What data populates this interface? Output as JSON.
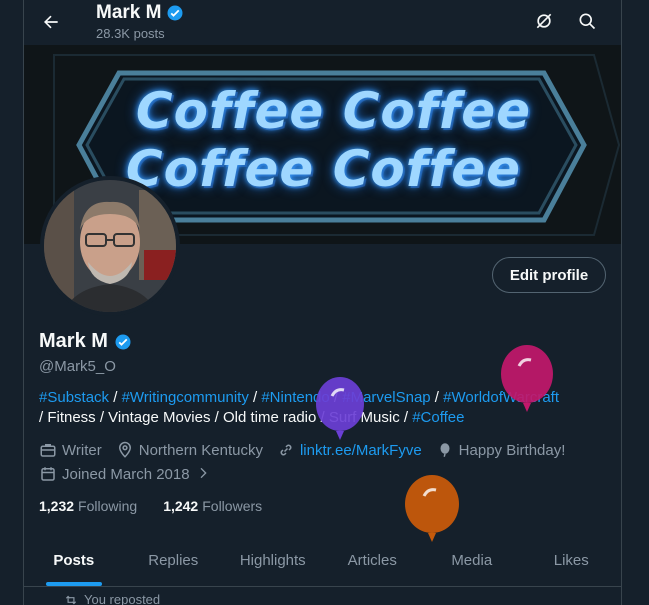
{
  "header": {
    "name": "Mark M",
    "posts_count": "28.3K posts"
  },
  "banner": {
    "line1": "Coffee Coffee",
    "line2": "Coffee Coffee"
  },
  "profile": {
    "edit_button": "Edit profile",
    "name": "Mark M",
    "handle": "@Mark5_O",
    "bio": {
      "tag1": "#Substack",
      "sep1": " / ",
      "tag2": "#Writingcommunity",
      "sep2": " / ",
      "tag3": "#Nintendo",
      "sep3": " / ",
      "tag4": "#MarvelSnap",
      "sep4": " / ",
      "tag5": "#WorldofWarcraft",
      "text": "/ Fitness / Vintage Movies / Old time radio / Surf Music / ",
      "tag6": "#Coffee"
    },
    "meta": {
      "profession": "Writer",
      "location": "Northern Kentucky",
      "link": "linktr.ee/MarkFyve",
      "birthday": "Happy Birthday!",
      "joined": "Joined March 2018"
    },
    "following_count": "1,232",
    "following_label": "Following",
    "followers_count": "1,242",
    "followers_label": "Followers"
  },
  "tabs": [
    {
      "label": "Posts",
      "active": true
    },
    {
      "label": "Replies"
    },
    {
      "label": "Highlights"
    },
    {
      "label": "Articles"
    },
    {
      "label": "Media"
    },
    {
      "label": "Likes"
    }
  ],
  "feed": {
    "reposted_label": "You reposted"
  },
  "colors": {
    "background": "#15202b",
    "accent": "#1d9bf0",
    "muted": "#8b98a5",
    "balloon_purple": "#6b3fd6",
    "balloon_magenta": "#c2186b",
    "balloon_orange": "#c65a0b"
  },
  "icons": [
    "back-arrow-icon",
    "verified-badge-icon",
    "grok-icon",
    "search-icon",
    "briefcase-icon",
    "location-pin-icon",
    "link-icon",
    "balloon-icon",
    "calendar-icon",
    "chevron-right-icon",
    "repost-icon"
  ]
}
